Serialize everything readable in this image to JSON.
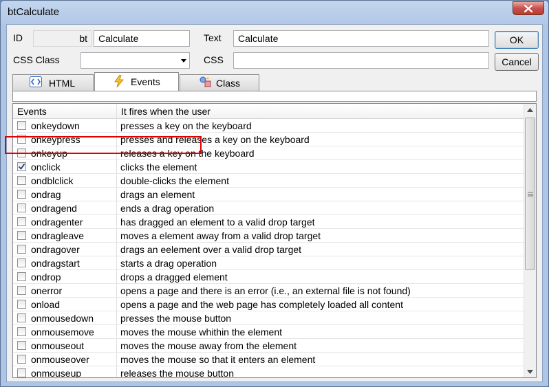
{
  "window": {
    "title": "btCalculate"
  },
  "form": {
    "id_label": "ID",
    "id_prefix": "bt",
    "id_value": "Calculate",
    "text_label": "Text",
    "text_value": "Calculate",
    "css_class_label": "CSS Class",
    "css_class_value": "",
    "css_label": "CSS",
    "css_value": ""
  },
  "buttons": {
    "ok": "OK",
    "cancel": "Cancel"
  },
  "tabs": [
    {
      "label": "HTML",
      "icon": "html-tag-icon",
      "active": false
    },
    {
      "label": "Events",
      "icon": "lightning-icon",
      "active": true
    },
    {
      "label": "Class",
      "icon": "class-icon",
      "active": false
    }
  ],
  "grid": {
    "columns": [
      "Events",
      "It fires when the user"
    ],
    "rows": [
      {
        "event": "onkeydown",
        "desc": "presses a key on the keyboard",
        "checked": false
      },
      {
        "event": "onkeypress",
        "desc": "presses and releases a key on the keyboard",
        "checked": false
      },
      {
        "event": "onkeyup",
        "desc": "releases a key on the keyboard",
        "checked": false
      },
      {
        "event": "onclick",
        "desc": "clicks the element",
        "checked": true
      },
      {
        "event": "ondblclick",
        "desc": "double-clicks the element",
        "checked": false
      },
      {
        "event": "ondrag",
        "desc": "drags an element",
        "checked": false
      },
      {
        "event": "ondragend",
        "desc": "ends a drag operation",
        "checked": false
      },
      {
        "event": "ondragenter",
        "desc": "has dragged an element to a valid drop target",
        "checked": false
      },
      {
        "event": "ondragleave",
        "desc": "moves a element away from a valid drop target",
        "checked": false
      },
      {
        "event": "ondragover",
        "desc": "drags an eelement over a valid drop target",
        "checked": false
      },
      {
        "event": "ondragstart",
        "desc": "starts a drag operation",
        "checked": false
      },
      {
        "event": "ondrop",
        "desc": "drops a dragged element",
        "checked": false
      },
      {
        "event": "onerror",
        "desc": "opens a page and there is an error (i.e., an external file is not found)",
        "checked": false
      },
      {
        "event": "onload",
        "desc": "opens a page and  the web page has completely loaded all content",
        "checked": false
      },
      {
        "event": "onmousedown",
        "desc": "presses the mouse button",
        "checked": false
      },
      {
        "event": "onmousemove",
        "desc": "moves the mouse whithin the element",
        "checked": false
      },
      {
        "event": "onmouseout",
        "desc": "moves the mouse away from the element",
        "checked": false
      },
      {
        "event": "onmouseover",
        "desc": "moves the mouse so that it enters an element",
        "checked": false
      },
      {
        "event": "onmouseup",
        "desc": "releases the mouse button",
        "checked": false
      }
    ]
  },
  "colors": {
    "highlight": "#e00000",
    "title_bar": "#c4d6ee",
    "close_button": "#c75050"
  }
}
